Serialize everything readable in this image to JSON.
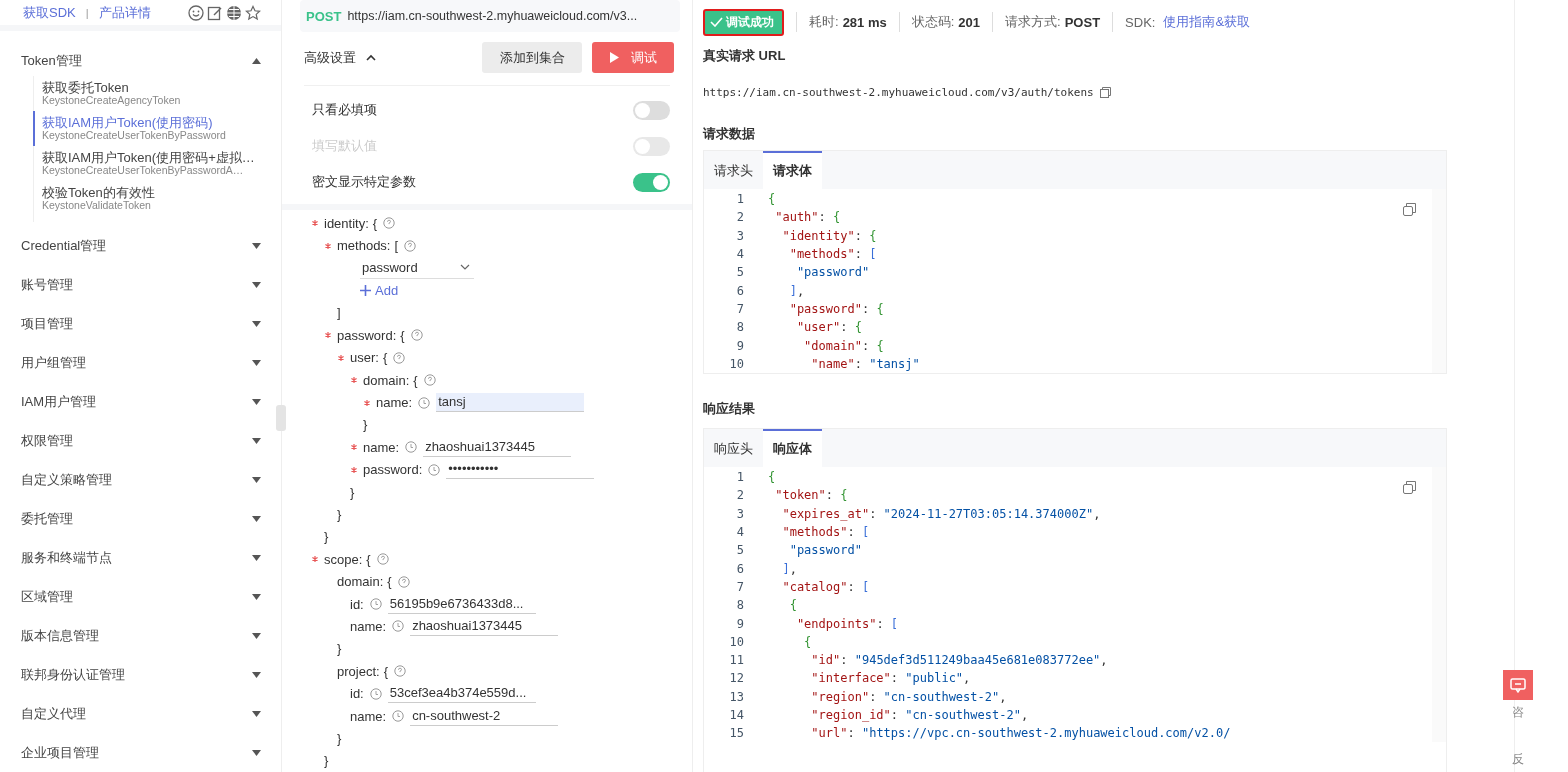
{
  "sidebar": {
    "links": [
      "获取SDK",
      "产品详情"
    ],
    "separator": "|",
    "groups": [
      {
        "label": "Token管理",
        "expanded": true,
        "items": [
          {
            "title": "获取委托Token",
            "subtitle": "KeystoneCreateAgencyToken",
            "selected": false
          },
          {
            "title": "获取IAM用户Token(使用密码)",
            "subtitle": "KeystoneCreateUserTokenByPassword",
            "selected": true
          },
          {
            "title": "获取IAM用户Token(使用密码+虚拟…",
            "subtitle": "KeystoneCreateUserTokenByPasswordA…",
            "selected": false
          },
          {
            "title": "校验Token的有效性",
            "subtitle": "KeystoneValidateToken",
            "selected": false
          }
        ]
      },
      {
        "label": "Credential管理",
        "expanded": false
      },
      {
        "label": "账号管理",
        "expanded": false
      },
      {
        "label": "项目管理",
        "expanded": false
      },
      {
        "label": "用户组管理",
        "expanded": false
      },
      {
        "label": "IAM用户管理",
        "expanded": false
      },
      {
        "label": "权限管理",
        "expanded": false
      },
      {
        "label": "自定义策略管理",
        "expanded": false
      },
      {
        "label": "委托管理",
        "expanded": false
      },
      {
        "label": "服务和终端节点",
        "expanded": false
      },
      {
        "label": "区域管理",
        "expanded": false
      },
      {
        "label": "版本信息管理",
        "expanded": false
      },
      {
        "label": "联邦身份认证管理",
        "expanded": false
      },
      {
        "label": "自定义代理",
        "expanded": false
      },
      {
        "label": "企业项目管理",
        "expanded": false
      }
    ]
  },
  "request": {
    "method": "POST",
    "url": "https://iam.cn-southwest-2.myhuaweicloud.com/v3...",
    "advanced_label": "高级设置",
    "advanced_expanded": true,
    "add_button": "添加到集合",
    "debug_button": "调试",
    "toggles": [
      {
        "label": "只看必填项",
        "on": false,
        "disabled": false
      },
      {
        "label": "填写默认值",
        "on": false,
        "disabled": true
      },
      {
        "label": "密文显示特定参数",
        "on": true,
        "disabled": false
      }
    ],
    "form": [
      {
        "kind": "group",
        "key": "identity:",
        "open": "{",
        "close": "}",
        "required": true,
        "children": [
          {
            "kind": "group",
            "key": "methods:",
            "open": "[",
            "close": "]",
            "required": true,
            "children": [
              {
                "kind": "select",
                "value": "password"
              },
              {
                "kind": "add",
                "label": "Add"
              }
            ]
          },
          {
            "kind": "group",
            "key": "password:",
            "open": "{",
            "close": "}",
            "required": true,
            "children": [
              {
                "kind": "group",
                "key": "user:",
                "open": "{",
                "close": "}",
                "required": true,
                "children": [
                  {
                    "kind": "group",
                    "key": "domain:",
                    "open": "{",
                    "close": "}",
                    "required": true,
                    "children": [
                      {
                        "kind": "field",
                        "key": "name:",
                        "value": "tansj",
                        "required": true,
                        "focused": true
                      }
                    ]
                  },
                  {
                    "kind": "field",
                    "key": "name:",
                    "value": "zhaoshuai1373445",
                    "required": true,
                    "focused": false
                  },
                  {
                    "kind": "field",
                    "key": "password:",
                    "value": "•••••••••••",
                    "required": true,
                    "focused": false
                  }
                ]
              }
            ]
          }
        ]
      },
      {
        "kind": "group",
        "key": "scope:",
        "open": "{",
        "close": "}",
        "required": true,
        "children": [
          {
            "kind": "group",
            "key": "domain:",
            "open": "{",
            "close": "}",
            "required": false,
            "children": [
              {
                "kind": "field",
                "key": "id:",
                "value": "56195b9e6736433d8...",
                "required": false,
                "focused": false
              },
              {
                "kind": "field",
                "key": "name:",
                "value": "zhaoshuai1373445",
                "required": false,
                "focused": false
              }
            ]
          },
          {
            "kind": "group",
            "key": "project:",
            "open": "{",
            "close": "}",
            "required": false,
            "children": [
              {
                "kind": "field",
                "key": "id:",
                "value": "53cef3ea4b374e559d...",
                "required": false,
                "focused": false
              },
              {
                "kind": "field",
                "key": "name:",
                "value": "cn-southwest-2",
                "required": false,
                "focused": false
              }
            ]
          }
        ]
      }
    ]
  },
  "result": {
    "status_badge": "调试成功",
    "badge_outlined": true,
    "stats": [
      {
        "label": "耗时:",
        "value": "281 ms"
      },
      {
        "label": "状态码:",
        "value": "201"
      },
      {
        "label": "请求方式:",
        "value": "POST"
      }
    ],
    "sdk_label": "SDK:",
    "sdk_link": "使用指南&获取",
    "url_title": "真实请求 URL",
    "url": "https://iam.cn-southwest-2.myhuaweicloud.com/v3/auth/tokens",
    "request_title": "请求数据",
    "request_tabs": [
      {
        "label": "请求头",
        "selected": false
      },
      {
        "label": "请求体",
        "selected": true
      }
    ],
    "request_lines": [
      {
        "n": "1",
        "tokens": [
          {
            "kind": "brace",
            "t": "{"
          }
        ]
      },
      {
        "n": "2",
        "tokens": [
          {
            "kind": "key",
            "t": " \"auth\""
          },
          {
            "kind": "plain",
            "t": ": "
          },
          {
            "kind": "brace",
            "t": "{"
          }
        ]
      },
      {
        "n": "3",
        "tokens": [
          {
            "kind": "key",
            "t": "  \"identity\""
          },
          {
            "kind": "plain",
            "t": ": "
          },
          {
            "kind": "brace",
            "t": "{"
          }
        ]
      },
      {
        "n": "4",
        "tokens": [
          {
            "kind": "key",
            "t": "   \"methods\""
          },
          {
            "kind": "plain",
            "t": ": "
          },
          {
            "kind": "bracket",
            "t": "["
          }
        ]
      },
      {
        "n": "5",
        "tokens": [
          {
            "kind": "str",
            "t": "    \"password\""
          }
        ]
      },
      {
        "n": "6",
        "tokens": [
          {
            "kind": "bracket",
            "t": "   ]"
          },
          {
            "kind": "plain",
            "t": ","
          }
        ]
      },
      {
        "n": "7",
        "tokens": [
          {
            "kind": "key",
            "t": "   \"password\""
          },
          {
            "kind": "plain",
            "t": ": "
          },
          {
            "kind": "brace",
            "t": "{"
          }
        ]
      },
      {
        "n": "8",
        "tokens": [
          {
            "kind": "key",
            "t": "    \"user\""
          },
          {
            "kind": "plain",
            "t": ": "
          },
          {
            "kind": "brace",
            "t": "{"
          }
        ]
      },
      {
        "n": "9",
        "tokens": [
          {
            "kind": "key",
            "t": "     \"domain\""
          },
          {
            "kind": "plain",
            "t": ": "
          },
          {
            "kind": "brace",
            "t": "{"
          }
        ]
      },
      {
        "n": "10",
        "tokens": [
          {
            "kind": "key",
            "t": "      \"name\""
          },
          {
            "kind": "plain",
            "t": ": "
          },
          {
            "kind": "str",
            "t": "\"tansj\""
          }
        ]
      }
    ],
    "response_title": "响应结果",
    "response_tabs": [
      {
        "label": "响应头",
        "selected": false
      },
      {
        "label": "响应体",
        "selected": true
      }
    ],
    "response_lines": [
      {
        "n": "1",
        "tokens": [
          {
            "kind": "brace",
            "t": "{"
          }
        ]
      },
      {
        "n": "2",
        "tokens": [
          {
            "kind": "key",
            "t": " \"token\""
          },
          {
            "kind": "plain",
            "t": ": "
          },
          {
            "kind": "brace",
            "t": "{"
          }
        ]
      },
      {
        "n": "3",
        "tokens": [
          {
            "kind": "key",
            "t": "  \"expires_at\""
          },
          {
            "kind": "plain",
            "t": ": "
          },
          {
            "kind": "str",
            "t": "\"2024-11-27T03:05:14.374000Z\""
          },
          {
            "kind": "plain",
            "t": ","
          }
        ]
      },
      {
        "n": "4",
        "tokens": [
          {
            "kind": "key",
            "t": "  \"methods\""
          },
          {
            "kind": "plain",
            "t": ": "
          },
          {
            "kind": "bracket",
            "t": "["
          }
        ]
      },
      {
        "n": "5",
        "tokens": [
          {
            "kind": "str",
            "t": "   \"password\""
          }
        ]
      },
      {
        "n": "6",
        "tokens": [
          {
            "kind": "bracket",
            "t": "  ]"
          },
          {
            "kind": "plain",
            "t": ","
          }
        ]
      },
      {
        "n": "7",
        "tokens": [
          {
            "kind": "key",
            "t": "  \"catalog\""
          },
          {
            "kind": "plain",
            "t": ": "
          },
          {
            "kind": "bracket",
            "t": "["
          }
        ]
      },
      {
        "n": "8",
        "tokens": [
          {
            "kind": "brace",
            "t": "   {"
          }
        ]
      },
      {
        "n": "9",
        "tokens": [
          {
            "kind": "key",
            "t": "    \"endpoints\""
          },
          {
            "kind": "plain",
            "t": ": "
          },
          {
            "kind": "bracket",
            "t": "["
          }
        ]
      },
      {
        "n": "10",
        "tokens": [
          {
            "kind": "brace",
            "t": "     {"
          }
        ]
      },
      {
        "n": "11",
        "tokens": [
          {
            "kind": "key",
            "t": "      \"id\""
          },
          {
            "kind": "plain",
            "t": ": "
          },
          {
            "kind": "str",
            "t": "\"945def3d511249baa45e681e083772ee\""
          },
          {
            "kind": "plain",
            "t": ","
          }
        ]
      },
      {
        "n": "12",
        "tokens": [
          {
            "kind": "key",
            "t": "      \"interface\""
          },
          {
            "kind": "plain",
            "t": ": "
          },
          {
            "kind": "str",
            "t": "\"public\""
          },
          {
            "kind": "plain",
            "t": ","
          }
        ]
      },
      {
        "n": "13",
        "tokens": [
          {
            "kind": "key",
            "t": "      \"region\""
          },
          {
            "kind": "plain",
            "t": ": "
          },
          {
            "kind": "str",
            "t": "\"cn-southwest-2\""
          },
          {
            "kind": "plain",
            "t": ","
          }
        ]
      },
      {
        "n": "14",
        "tokens": [
          {
            "kind": "key",
            "t": "      \"region_id\""
          },
          {
            "kind": "plain",
            "t": ": "
          },
          {
            "kind": "str",
            "t": "\"cn-southwest-2\""
          },
          {
            "kind": "plain",
            "t": ","
          }
        ]
      },
      {
        "n": "15",
        "tokens": [
          {
            "kind": "key",
            "t": "      \"url\""
          },
          {
            "kind": "plain",
            "t": ": "
          },
          {
            "kind": "str",
            "t": "\"https://vpc.cn-southwest-2.myhuaweicloud.com/v2.0/"
          }
        ]
      }
    ]
  },
  "consult_tab": {
    "labels": [
      "咨",
      "反"
    ]
  }
}
